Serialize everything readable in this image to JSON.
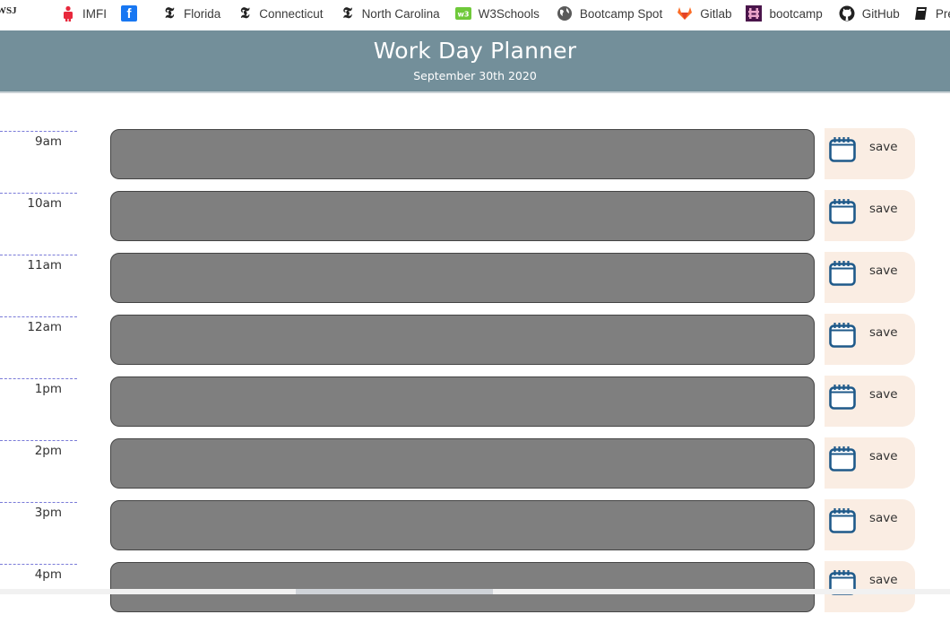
{
  "bookmarks": [
    {
      "label": "",
      "icon": "wsj-icon",
      "icon_text": "WSJ"
    },
    {
      "label": "IMFI",
      "icon": "imfi-icon"
    },
    {
      "label": "",
      "icon": "facebook-icon",
      "icon_text": "f"
    },
    {
      "label": "Florida",
      "icon": "nyt-icon",
      "icon_text": "𝕿"
    },
    {
      "label": "Connecticut",
      "icon": "nyt-icon",
      "icon_text": "𝕿"
    },
    {
      "label": "North Carolina",
      "icon": "nyt-icon",
      "icon_text": "𝕿"
    },
    {
      "label": "W3Schools",
      "icon": "w3schools-icon"
    },
    {
      "label": "Bootcamp Spot",
      "icon": "globe-icon"
    },
    {
      "label": "Gitlab",
      "icon": "gitlab-icon"
    },
    {
      "label": "bootcamp",
      "icon": "slack-icon"
    },
    {
      "label": "GitHub",
      "icon": "github-icon"
    },
    {
      "label": "Pre-Work",
      "icon": "book-icon"
    }
  ],
  "header": {
    "title": "Work Day Planner",
    "date": "September 30th 2020"
  },
  "colors": {
    "header_bg": "#738f9a",
    "textarea_past": "#7f7f7f",
    "save_bg": "#faede3",
    "calendar_icon": "#1f5a8a"
  },
  "rows": [
    {
      "hour": "9am",
      "text": "",
      "save_label": "save"
    },
    {
      "hour": "10am",
      "text": "",
      "save_label": "save"
    },
    {
      "hour": "11am",
      "text": "",
      "save_label": "save"
    },
    {
      "hour": "12am",
      "text": "",
      "save_label": "save"
    },
    {
      "hour": "1pm",
      "text": "",
      "save_label": "save"
    },
    {
      "hour": "2pm",
      "text": "",
      "save_label": "save"
    },
    {
      "hour": "3pm",
      "text": "",
      "save_label": "save"
    },
    {
      "hour": "4pm",
      "text": "",
      "save_label": "save"
    }
  ]
}
